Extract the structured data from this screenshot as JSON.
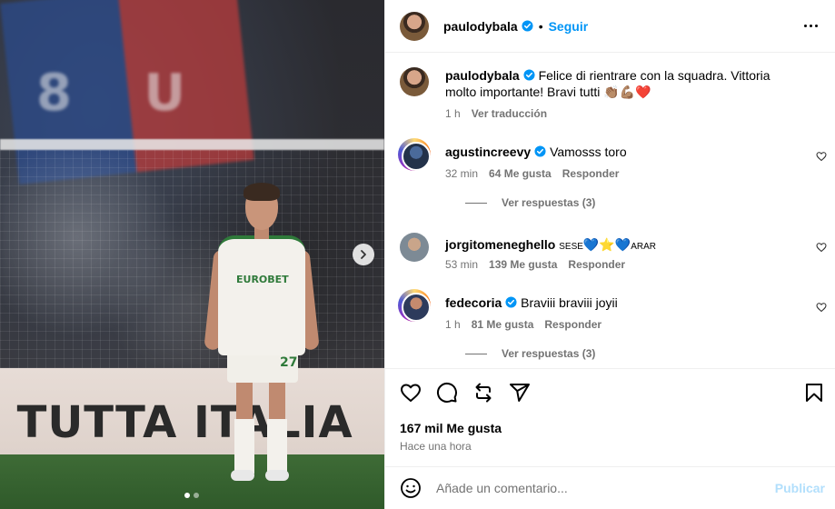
{
  "post": {
    "author": "paulodybala",
    "separator": "•",
    "follow_label": "Seguir",
    "caption_text": "Felice di rientrare con la squadra. Vittoria molto importante! Bravi tutti",
    "caption_emojis": "👏🏽💪🏽❤️",
    "caption_time": "1 h",
    "translate_label": "Ver traducción"
  },
  "media": {
    "banner_text": "I TUTTA ITALIA",
    "sponsor_text": "EUROBET",
    "shirt_number": "27",
    "next_icon": "chevron-right-icon",
    "slide_count": 2,
    "active_slide": 0
  },
  "comments": [
    {
      "user": "agustincreevy",
      "verified": true,
      "text": "Vamosss toro",
      "time": "32 min",
      "likes": "64 Me gusta",
      "reply_label": "Responder",
      "view_replies": "Ver respuestas (3)"
    },
    {
      "user": "jorgitomeneghello",
      "verified": false,
      "text_prefix": "SESE",
      "text_emojis": "💙⭐💙",
      "text_suffix": "ARAR",
      "time": "53 min",
      "likes": "139 Me gusta",
      "reply_label": "Responder"
    },
    {
      "user": "fedecoria",
      "verified": true,
      "text": "Braviii braviii joyii",
      "time": "1 h",
      "likes": "81 Me gusta",
      "reply_label": "Responder",
      "view_replies": "Ver respuestas (3)"
    }
  ],
  "footer": {
    "likes_label": "167 mil Me gusta",
    "time_label": "Hace una hora",
    "comment_placeholder": "Añade un comentario...",
    "publish_label": "Publicar"
  },
  "colors": {
    "accent": "#0095f6",
    "publish_disabled": "#b2dffc",
    "secondary_text": "#737373",
    "divider": "#efefef"
  }
}
